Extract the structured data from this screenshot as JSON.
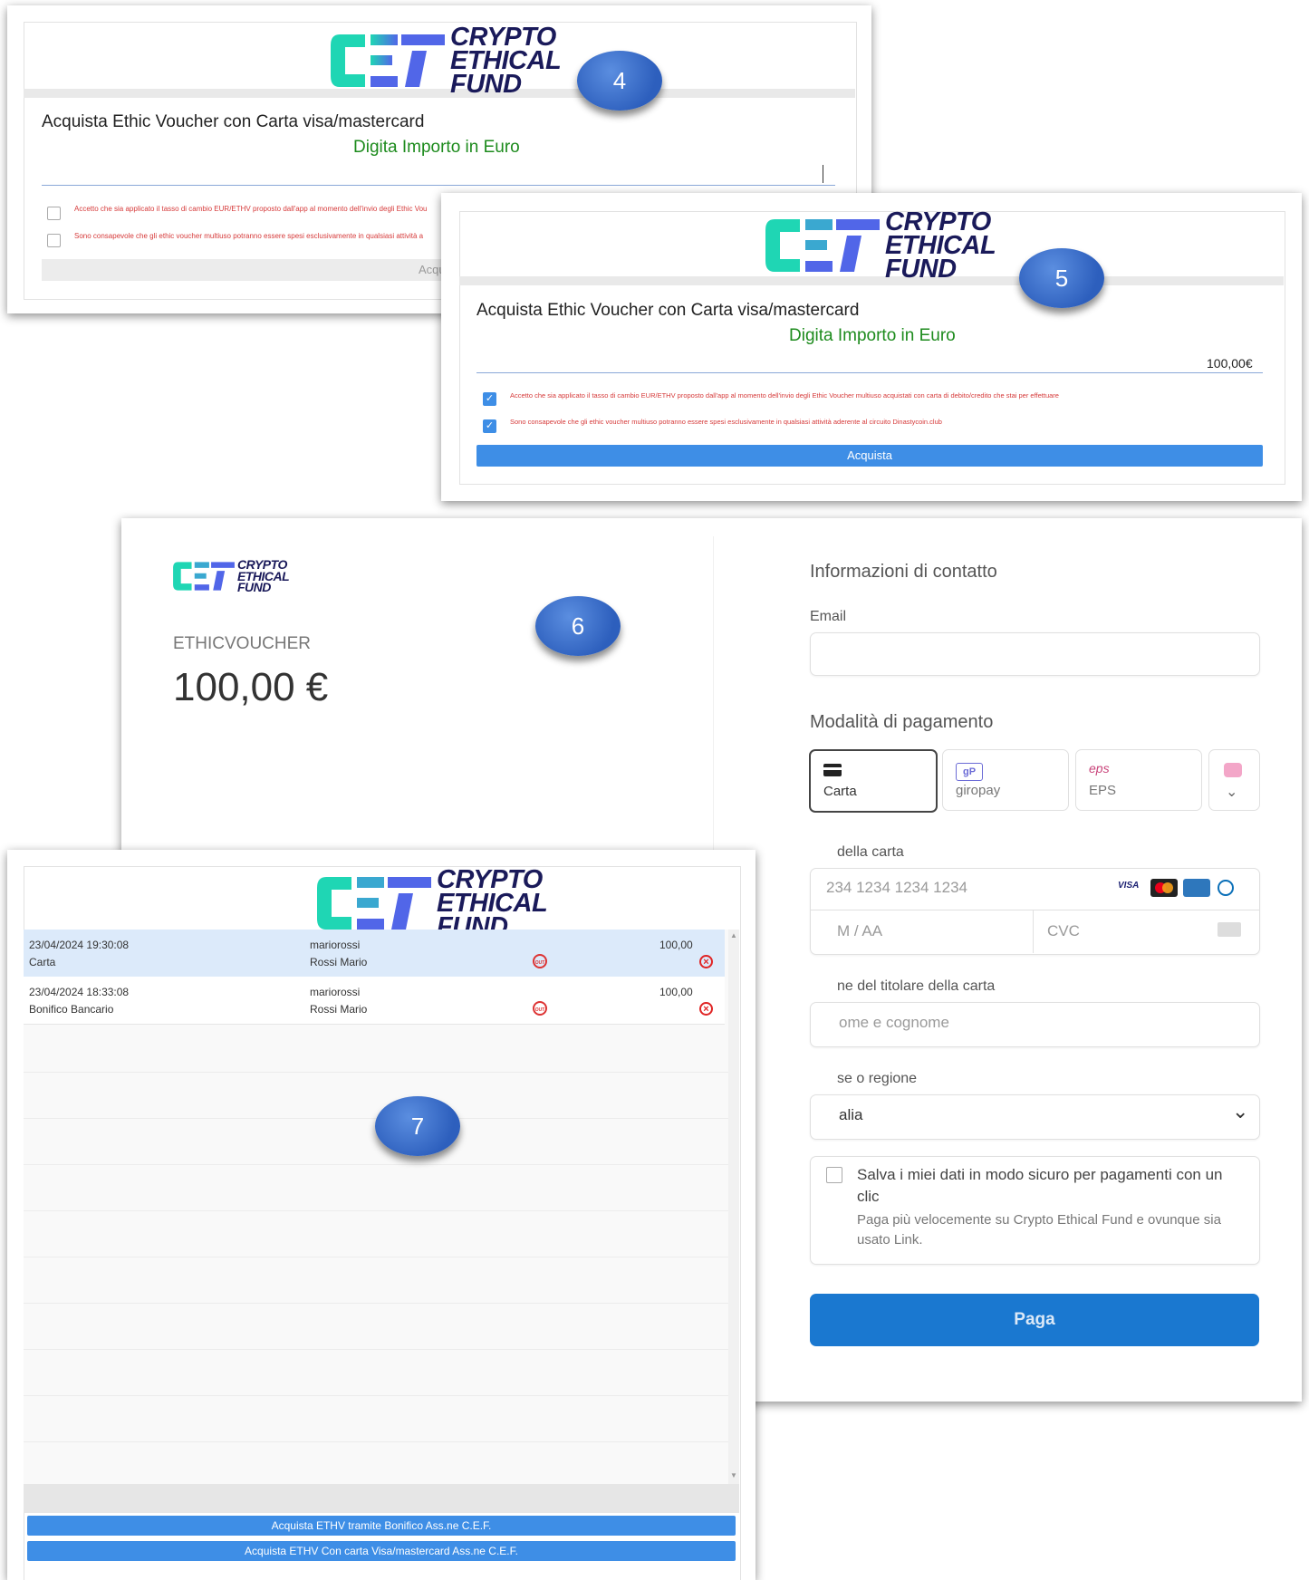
{
  "brand": {
    "line1": "CRYPTO",
    "line2": "ETHICAL",
    "line3": "FUND",
    "colors": {
      "teal": "#1fd6b4",
      "blue": "#5166e8",
      "dark": "#1a1a5a"
    }
  },
  "steps": [
    "4",
    "5",
    "6",
    "7"
  ],
  "panel4": {
    "title": "Acquista Ethic Voucher con Carta visa/mastercard",
    "subtitle": "Digita Importo in Euro",
    "check1": "Accetto che sia applicato il tasso di cambio EUR/ETHV proposto dall'app al momento dell'invio degli Ethic Vou",
    "check2": "Sono consapevole che gli ethic voucher multiuso potranno essere spesi esclusivamente in qualsiasi attività a",
    "button": "Acqu"
  },
  "panel5": {
    "title": "Acquista Ethic Voucher con Carta visa/mastercard",
    "subtitle": "Digita Importo in Euro",
    "amount": "100,00€",
    "check1": "Accetto che sia applicato il tasso di cambio EUR/ETHV proposto dall'app al momento dell'invio degli Ethic Voucher multiuso acquistati con carta di debito/credito che stai per effettuare",
    "check2": "Sono consapevole che gli ethic voucher multiuso potranno essere spesi esclusivamente in qualsiasi attività aderente al circuito Dinastycoin.club",
    "button": "Acquista"
  },
  "panel6": {
    "product": "ETHICVOUCHER",
    "price": "100,00 €",
    "contact_heading": "Informazioni di contatto",
    "email_label": "Email",
    "payment_heading": "Modalità di pagamento",
    "methods": [
      {
        "icon": "card-icon",
        "label": "Carta"
      },
      {
        "icon": "giropay-icon",
        "label": "giropay"
      },
      {
        "icon": "eps-icon",
        "label": "EPS"
      }
    ],
    "card_label": "della carta",
    "card_placeholder": "234 1234 1234 1234",
    "brands": [
      "VISA",
      "mastercard",
      "amex",
      "diners"
    ],
    "expiry_placeholder": "M / AA",
    "cvc_placeholder": "CVC",
    "holder_label": "ne del titolare della carta",
    "holder_placeholder": "ome e cognome",
    "country_label": "se o regione",
    "country_value": "alia",
    "save_title": "Salva i miei dati in modo sicuro per pagamenti con un clic",
    "save_sub": "Paga più velocemente su Crypto Ethical Fund e ovunque sia usato Link.",
    "pay_button": "Paga"
  },
  "panel7": {
    "rows": [
      {
        "datetime": "23/04/2024 19:30:08",
        "method": "Carta",
        "user": "mariorossi",
        "name": "Rossi Mario",
        "amount": "100,00"
      },
      {
        "datetime": "23/04/2024 18:33:08",
        "method": "Bonifico Bancario",
        "user": "mariorossi",
        "name": "Rossi Mario",
        "amount": "100,00"
      }
    ],
    "out_label": "OUT",
    "button1": "Acquista ETHV tramite Bonifico Ass.ne C.E.F.",
    "button2": "Acquista ETHV Con carta Visa/mastercard Ass.ne C.E.F."
  }
}
